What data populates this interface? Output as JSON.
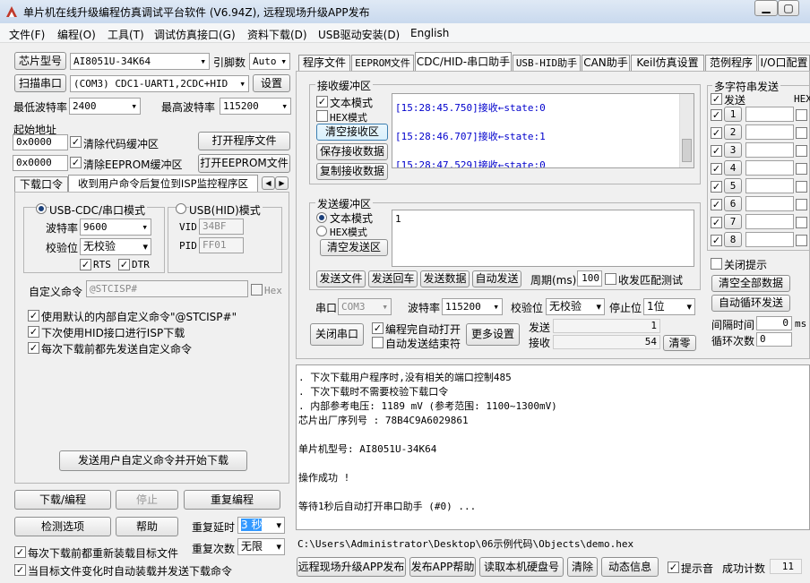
{
  "window": {
    "title": "单片机在线升级编程仿真调试平台软件 (V6.94Z), 远程现场升级APP发布"
  },
  "menu": [
    "文件(F)",
    "编程(O)",
    "工具(T)",
    "调试仿真接口(G)",
    "资料下载(D)",
    "USB驱动安装(D)",
    "English"
  ],
  "left": {
    "chip_btn": "芯片型号",
    "chip_value": "AI8051U-34K64",
    "pin_label": "引脚数",
    "pin_value": "Auto",
    "scan_btn": "扫描串口",
    "port_value": "(COM3) CDC1-UART1,2CDC+HID",
    "settings_btn": "设置",
    "min_baud_label": "最低波特率",
    "min_baud_value": "2400",
    "max_baud_label": "最高波特率",
    "max_baud_value": "115200",
    "start_addr_label": "起始地址",
    "addr1": "0x0000",
    "clear_code_label": "清除代码缓冲区",
    "open_prog_btn": "打开程序文件",
    "addr2": "0x0000",
    "clear_eeprom_label": "清除EEPROM缓冲区",
    "open_eeprom_btn": "打开EEPROM文件",
    "tab1": "下载口令",
    "tab2": "收到用户命令后复位到ISP监控程序区",
    "mode1": "USB-CDC/串口模式",
    "mode2": "USB(HID)模式",
    "baud_label": "波特率",
    "baud_value": "9600",
    "parity_label": "校验位",
    "parity_value": "无校验",
    "rts": "RTS",
    "dtr": "DTR",
    "vid_label": "VID",
    "vid_value": "34BF",
    "pid_label": "PID",
    "pid_value": "FF01",
    "custom_cmd_label": "自定义命令",
    "custom_cmd_value": "@STCISP#",
    "hex_label": "Hex",
    "opt1": "使用默认的内部自定义命令\"@STCISP#\"",
    "opt2": "下次使用HID接口进行ISP下载",
    "opt3": "每次下载前都先发送自定义命令",
    "send_cmd_btn": "发送用户自定义命令并开始下载",
    "download_btn": "下载/编程",
    "stop_btn": "停止",
    "reprogram_btn": "重复编程",
    "check_btn": "检测选项",
    "help_btn": "帮助",
    "delay_label": "重复延时",
    "delay_value": "3 秒",
    "count_label": "重复次数",
    "count_value": "无限",
    "bottom_opt1": "每次下载前都重新装载目标文件",
    "bottom_opt2": "当目标文件变化时自动装载并发送下载命令"
  },
  "tabs": [
    "程序文件",
    "EEPROM文件",
    "CDC/HID-串口助手",
    "USB-HID助手",
    "CAN助手",
    "Keil仿真设置",
    "范例程序",
    "I/O口配置"
  ],
  "serial": {
    "recv_title": "接收缓冲区",
    "text_mode": "文本模式",
    "hex_mode": "HEX模式",
    "clear_recv_btn": "清空接收区",
    "save_recv_btn": "保存接收数据",
    "copy_recv_btn": "复制接收数据",
    "recv_lines": [
      "[15:28:45.750]接收←state:0",
      "[15:28:46.707]接收←state:1",
      "[15:28:47.529]接收←state:0"
    ],
    "send_title": "发送缓冲区",
    "send_text_mode": "文本模式",
    "send_hex_mode": "HEX模式",
    "clear_send_btn": "清空发送区",
    "send_content": "1",
    "send_file_btn": "发送文件",
    "send_cr_btn": "发送回车",
    "send_data_btn": "发送数据",
    "auto_send_btn": "自动发送",
    "period_label": "周期(ms)",
    "period_value": "100",
    "loopback_label": "收发匹配测试",
    "port_label": "串口",
    "port_value": "COM3",
    "baud_label": "波特率",
    "baud_value": "115200",
    "parity_label": "校验位",
    "parity_value": "无校验",
    "stop_label": "停止位",
    "stop_value": "1位",
    "close_port_btn": "关闭串口",
    "auto_open_label": "编程完自动打开",
    "auto_end_label": "自动发送结束符",
    "more_btn": "更多设置",
    "sent_label": "发送",
    "sent_value": "1",
    "recv_label": "接收",
    "recv_value": "54",
    "clear_count_btn": "清零"
  },
  "multi": {
    "title": "多字符串发送",
    "send_col": "发送",
    "hex_col": "HEX",
    "rows": [
      "1",
      "2",
      "3",
      "4",
      "5",
      "6",
      "7",
      "8"
    ],
    "close_hint": "关闭提示",
    "clear_all_btn": "清空全部数据",
    "auto_loop_btn": "自动循环发送",
    "interval_label": "间隔时间",
    "interval_value": "0",
    "interval_unit": "ms",
    "loop_label": "循环次数",
    "loop_value": "0"
  },
  "log": {
    "lines": [
      "  . 下次下载用户程序时,没有相关的端口控制485",
      "  . 下次下载时不需要校验下载口令",
      "  . 内部参考电压: 1189 mV (参考范围: 1100~1300mV)",
      "芯片出厂序列号 : 78B4C9A6029861",
      "",
      "  单片机型号: AI8051U-34K64",
      "",
      "操作成功 !",
      "",
      "等待1秒后自动打开串口助手 (#0) ..."
    ],
    "path": "C:\\Users\\Administrator\\Desktop\\06示例代码\\Objects\\demo.hex"
  },
  "bottom": {
    "remote_btn": "远程现场升级APP发布",
    "publish_help_btn": "发布APP帮助",
    "read_disk_btn": "读取本机硬盘号",
    "clear_btn": "清除",
    "anim_btn": "动态信息",
    "beep_label": "提示音",
    "success_label": "成功计数",
    "success_value": "11"
  }
}
